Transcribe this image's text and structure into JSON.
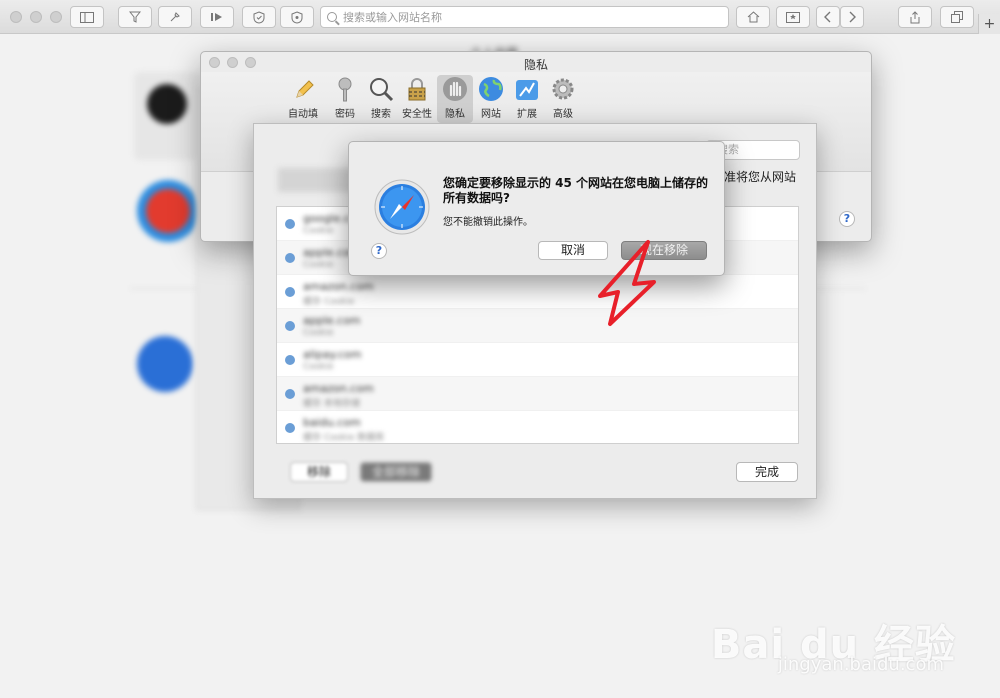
{
  "browser": {
    "search_placeholder": "搜索或输入网站名称",
    "new_tab_symbol": "+"
  },
  "background": {
    "favorites_title": "个人收藏"
  },
  "prefs": {
    "title": "隐私",
    "tabs": [
      {
        "label": "自动填充",
        "icon": "pencil-icon"
      },
      {
        "label": "密码",
        "icon": "key-icon"
      },
      {
        "label": "搜索",
        "icon": "magnifier-icon"
      },
      {
        "label": "安全性",
        "icon": "lock-icon"
      },
      {
        "label": "隐私",
        "icon": "hand-icon",
        "active": true
      },
      {
        "label": "网站",
        "icon": "globe-icon"
      },
      {
        "label": "扩展",
        "icon": "puzzle-icon"
      },
      {
        "label": "高级",
        "icon": "gear-icon"
      }
    ],
    "right_text": "准将您从网站"
  },
  "sheet": {
    "search_placeholder": "搜索",
    "rows": [
      {
        "site": "google.com",
        "meta": "Cookie"
      },
      {
        "site": "apple.com",
        "meta": "Cookie"
      },
      {
        "site": "amazon.com",
        "meta": "缓存 Cookie"
      },
      {
        "site": "apple.com",
        "meta": "Cookie"
      },
      {
        "site": "alipay.com",
        "meta": "Cookie"
      },
      {
        "site": "amazon.com",
        "meta": "缓存 本地存储"
      },
      {
        "site": "baidu.com",
        "meta": "缓存 Cookie 数据库"
      }
    ],
    "remove_label": "移除",
    "remove_all_label": "全部移除",
    "done_label": "完成"
  },
  "alert": {
    "title": "您确定要移除显示的 45 个网站在您电脑上储存的所有数据吗?",
    "subtitle": "您不能撤销此操作。",
    "cancel_label": "取消",
    "confirm_label": "现在移除",
    "help_label": "?"
  },
  "watermark": {
    "brand": "Bai du 经验",
    "url": "jingyan.baidu.com"
  },
  "colors": {
    "accent": "#2f68c9",
    "arrow": "#e8202a"
  }
}
